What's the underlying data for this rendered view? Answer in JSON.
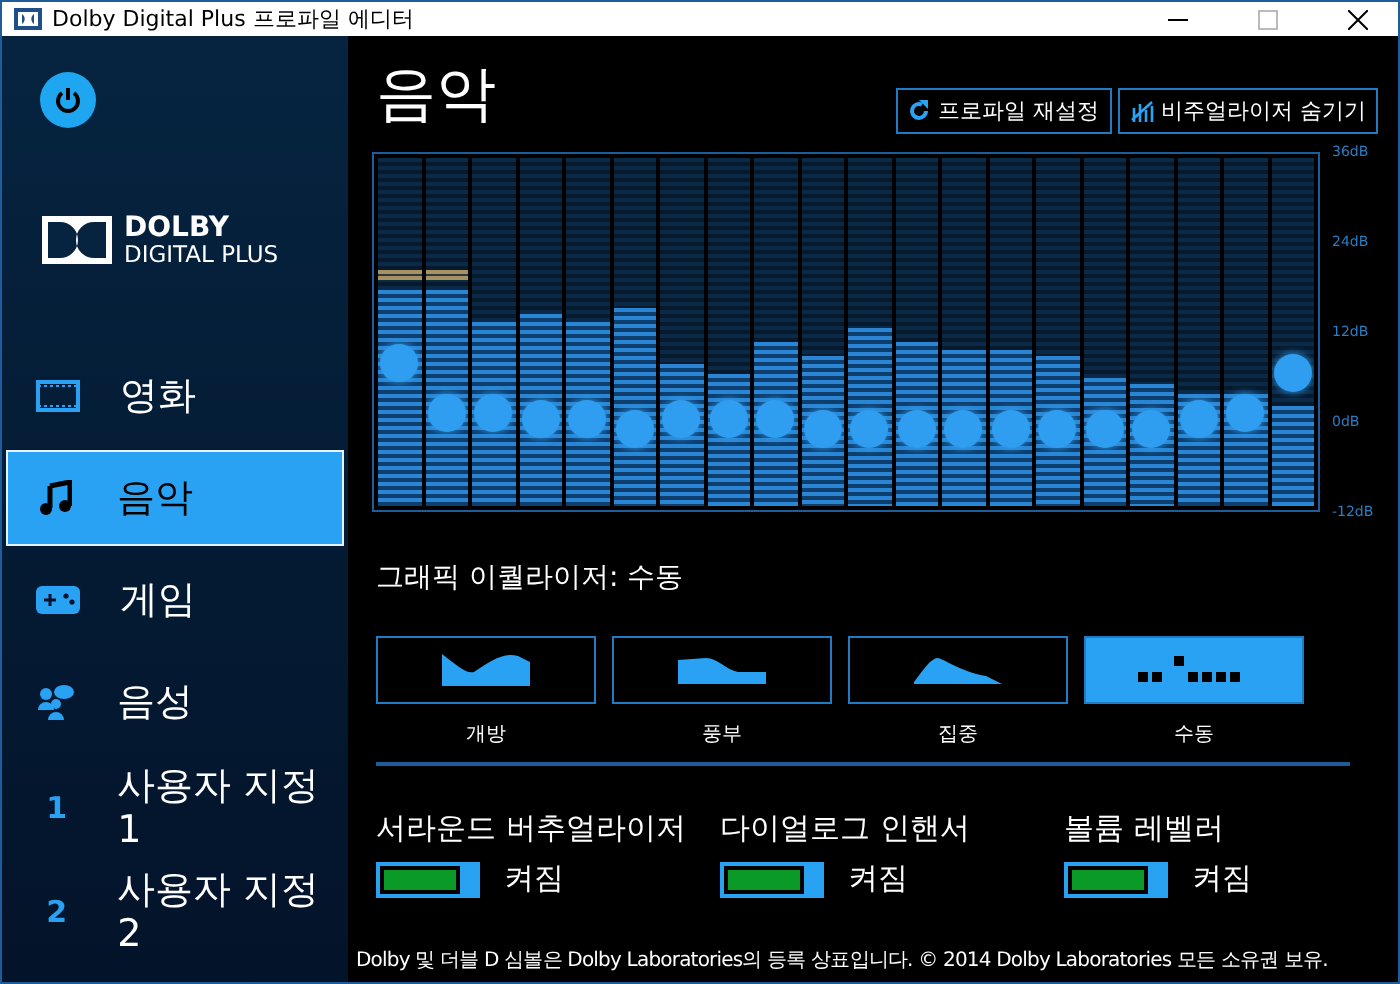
{
  "window": {
    "title": "Dolby Digital Plus 프로파일 에디터"
  },
  "sidebar": {
    "logo": {
      "brand": "DOLBY",
      "product": "DIGITAL PLUS"
    },
    "items": [
      {
        "label": "영화",
        "selected": false
      },
      {
        "label": "음악",
        "selected": true
      },
      {
        "label": "게임",
        "selected": false
      },
      {
        "label": "음성",
        "selected": false
      },
      {
        "label": "사용자 지정 1",
        "badge": "1",
        "selected": false
      },
      {
        "label": "사용자 지정 2",
        "badge": "2",
        "selected": false
      }
    ]
  },
  "page": {
    "title": "음악",
    "actions": [
      "프로파일 재설정",
      "비주얼라이저 숨기기"
    ]
  },
  "equalizer": {
    "axis_labels": [
      "36dB",
      "24dB",
      "12dB",
      "0dB",
      "-12dB"
    ],
    "bands": [
      {
        "level": 0.41
      },
      {
        "level": 0.27
      },
      {
        "level": 0.27
      },
      {
        "level": 0.25
      },
      {
        "level": 0.25
      },
      {
        "level": 0.22
      },
      {
        "level": 0.25
      },
      {
        "level": 0.25
      },
      {
        "level": 0.25
      },
      {
        "level": 0.22
      },
      {
        "level": 0.22
      },
      {
        "level": 0.22
      },
      {
        "level": 0.22
      },
      {
        "level": 0.22
      },
      {
        "level": 0.22
      },
      {
        "level": 0.22
      },
      {
        "level": 0.22
      },
      {
        "level": 0.25
      },
      {
        "level": 0.27
      },
      {
        "level": 0.38
      }
    ],
    "mode_label": "그래픽 이퀄라이저: 수동",
    "presets": [
      {
        "label": "개방",
        "selected": false
      },
      {
        "label": "풍부",
        "selected": false
      },
      {
        "label": "집중",
        "selected": false
      },
      {
        "label": "수동",
        "selected": true
      }
    ]
  },
  "toggles": [
    {
      "label": "서라운드 버추얼라이저",
      "state": "켜짐",
      "on": true
    },
    {
      "label": "다이얼로그 인핸서",
      "state": "켜짐",
      "on": true
    },
    {
      "label": "볼륨 레벨러",
      "state": "켜짐",
      "on": true
    }
  ],
  "footer": "Dolby 및 더블 D 심볼은 Dolby Laboratories의 등록 상표입니다. © 2014 Dolby Laboratories 모든 소유권 보유."
}
